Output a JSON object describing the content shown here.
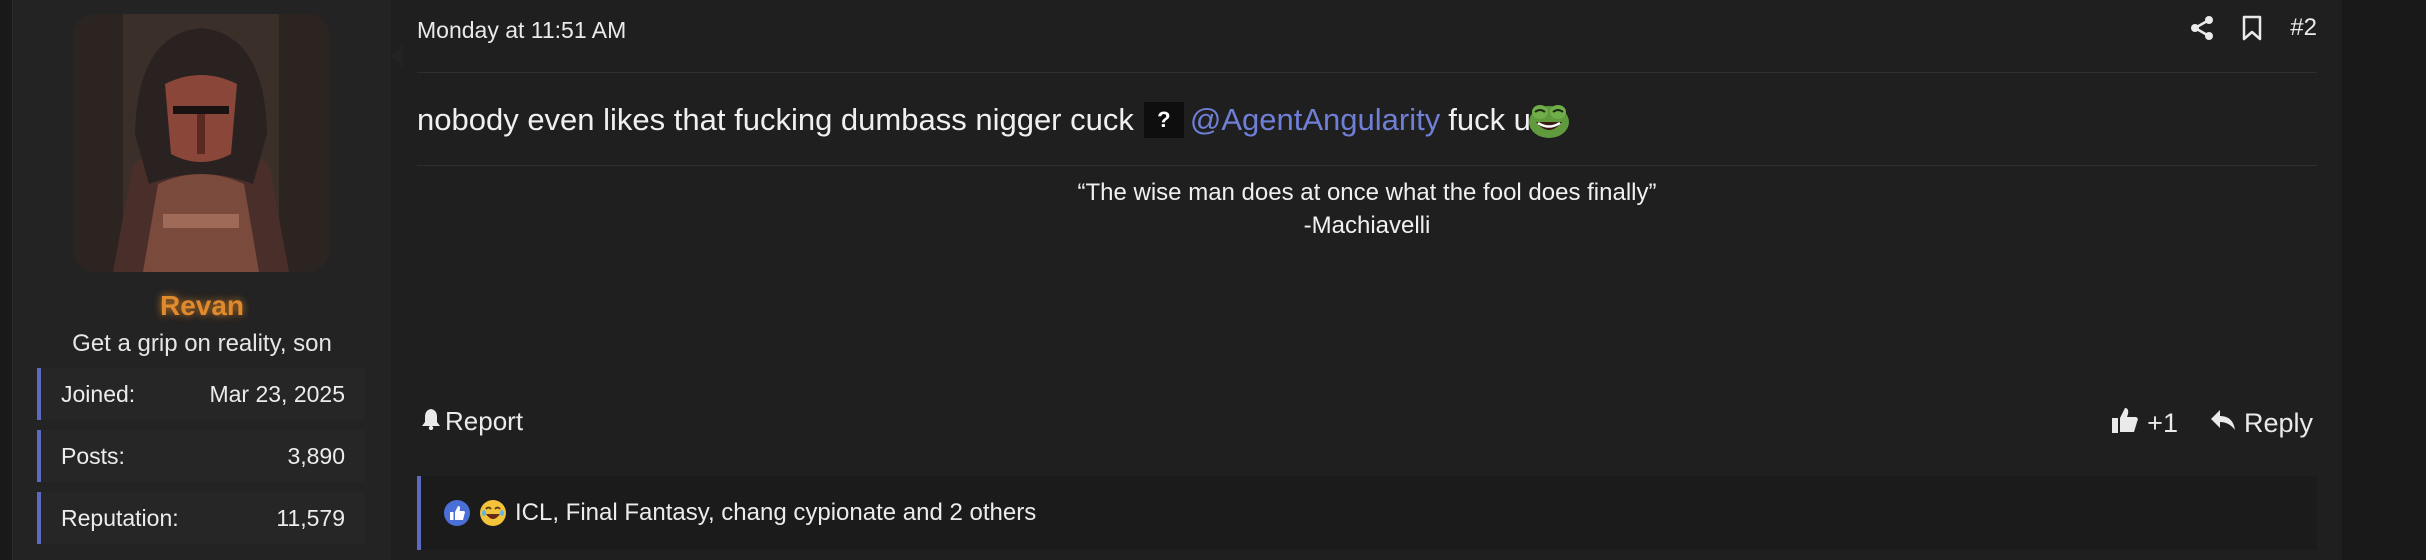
{
  "user": {
    "name": "Revan",
    "title": "Get a grip on reality, son",
    "name_color": "#e08a2e",
    "stats": [
      {
        "label": "Joined:",
        "value": "Mar 23, 2025"
      },
      {
        "label": "Posts:",
        "value": "3,890"
      },
      {
        "label": "Reputation:",
        "value": "11,579"
      }
    ]
  },
  "post": {
    "timestamp": "Monday at 11:51 AM",
    "number": "#2",
    "message": {
      "text_before": "nobody even likes that fucking dumbass nigger cuck",
      "unknown_glyph": "?",
      "mention": "@AgentAngularity",
      "text_after": "fuck u",
      "emoji_icon": "laughing-frog-emoji-icon"
    },
    "signature": {
      "quote": "“The wise man does at once what the fool does finally”",
      "author": "-Machiavelli"
    },
    "actions": {
      "report_label": "Report",
      "like_count": "+1",
      "reply_label": "Reply"
    },
    "reactions": {
      "icons": [
        "like-icon",
        "laughing-emoji-icon"
      ],
      "text": "ICL, Final Fantasy, chang cypionate and 2 others"
    }
  },
  "colors": {
    "accent": "#5c6bc0",
    "mention": "#6f7fd6",
    "background": "#1f1f1f"
  }
}
